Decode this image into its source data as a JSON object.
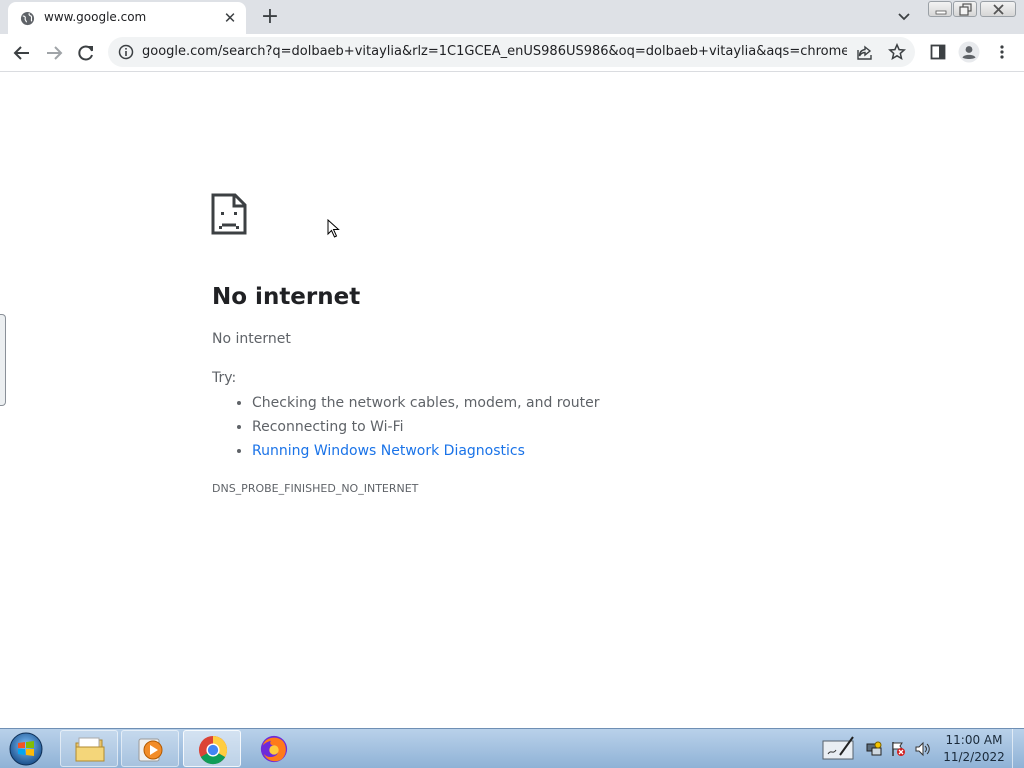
{
  "browser": {
    "tab": {
      "title": "www.google.com",
      "favicon": "globe-icon"
    },
    "url": "google.com/search?q=dolbaeb+vitaylia&rlz=1C1GCEA_enUS986US986&oq=dolbaeb+vitaylia&aqs=chrome..69i...",
    "toolbar_icons": [
      "back-arrow-icon",
      "forward-arrow-icon",
      "reload-icon",
      "info-icon",
      "share-icon",
      "star-icon",
      "side-panel-icon",
      "profile-icon",
      "menu-dots-icon"
    ]
  },
  "error_page": {
    "title": "No internet",
    "subtitle": "No internet",
    "try_label": "Try:",
    "suggestions": [
      {
        "text": "Checking the network cables, modem, and router",
        "link": false
      },
      {
        "text": "Reconnecting to Wi-Fi",
        "link": false
      },
      {
        "text": "Running Windows Network Diagnostics",
        "link": true
      }
    ],
    "error_code": "DNS_PROBE_FINISHED_NO_INTERNET",
    "link_color": "#1a73e8"
  },
  "taskbar": {
    "apps": [
      "windows-explorer",
      "media-player",
      "chrome",
      "firefox"
    ],
    "active_app": "chrome",
    "clock": {
      "time": "11:00 AM",
      "date": "11/2/2022"
    }
  }
}
